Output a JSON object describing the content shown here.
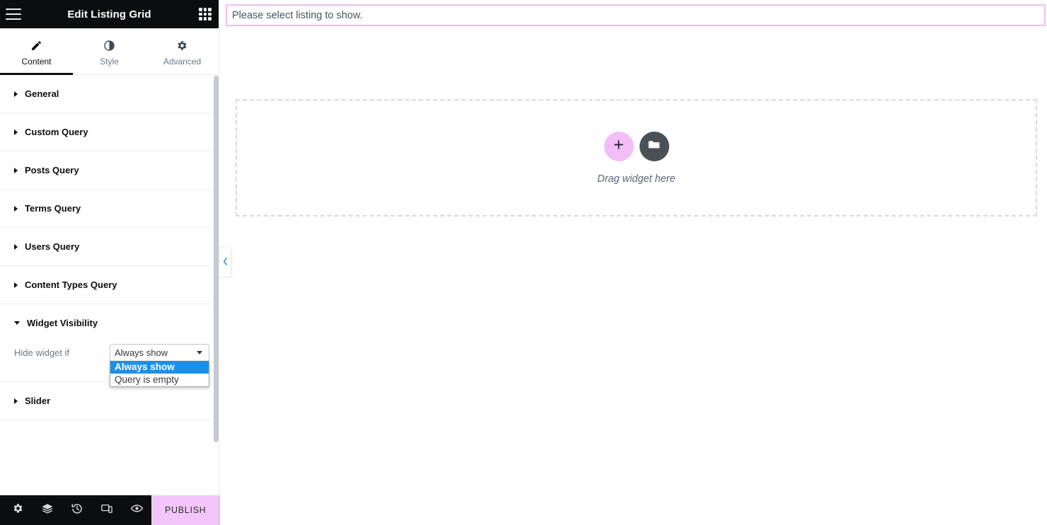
{
  "panel": {
    "header": {
      "title": "Edit Listing Grid",
      "menu_icon": "hamburger-icon",
      "grid_icon": "widgets-grid-icon"
    },
    "tabs": [
      {
        "label": "Content",
        "icon": "pencil-icon",
        "active": true
      },
      {
        "label": "Style",
        "icon": "contrast-icon",
        "active": false
      },
      {
        "label": "Advanced",
        "icon": "gear-icon",
        "active": false
      }
    ],
    "sections": [
      {
        "label": "General",
        "open": false
      },
      {
        "label": "Custom Query",
        "open": false
      },
      {
        "label": "Posts Query",
        "open": false
      },
      {
        "label": "Terms Query",
        "open": false
      },
      {
        "label": "Users Query",
        "open": false
      },
      {
        "label": "Content Types Query",
        "open": false
      },
      {
        "label": "Widget Visibility",
        "open": true
      },
      {
        "label": "Slider",
        "open": false
      }
    ],
    "widget_visibility": {
      "field_label": "Hide widget if",
      "selected_value": "Always show",
      "options": [
        {
          "label": "Always show",
          "selected": true
        },
        {
          "label": "Query is empty",
          "selected": false
        }
      ]
    },
    "footer": {
      "tools": [
        {
          "icon": "gear-icon",
          "name": "settings"
        },
        {
          "icon": "layers-icon",
          "name": "navigator"
        },
        {
          "icon": "history-icon",
          "name": "history"
        },
        {
          "icon": "responsive-icon",
          "name": "responsive-mode"
        },
        {
          "icon": "eye-icon",
          "name": "preview-changes"
        }
      ],
      "publish_label": "PUBLISH",
      "publish_caret_icon": "chevron-up-icon"
    },
    "collapse_handle_icon": "chevron-left-icon"
  },
  "canvas": {
    "notice_text": "Please select listing to show.",
    "dropzone": {
      "add_icon": "plus-icon",
      "folder_icon": "folder-icon",
      "text": "Drag widget here"
    }
  },
  "colors": {
    "header_bg": "#0c0d0e",
    "accent_pink": "#f3bdf7",
    "select_highlight": "#1e8fe8",
    "dark_circle": "#495157"
  }
}
